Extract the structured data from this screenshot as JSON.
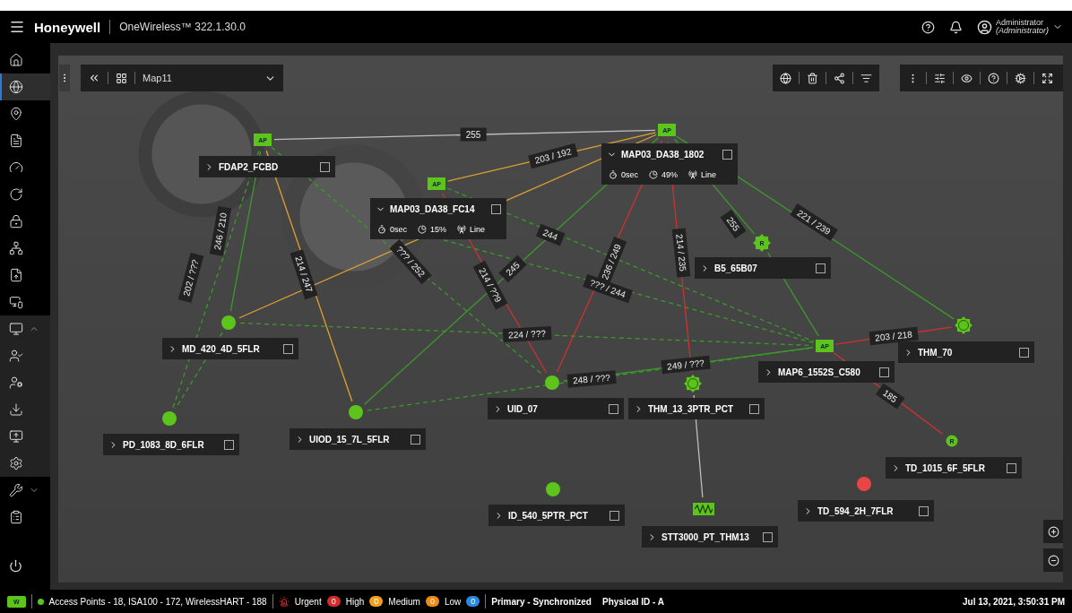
{
  "header": {
    "brand": "Honeywell",
    "product": "OneWireless™ 322.1.30.0",
    "user": {
      "name": "Administrator",
      "role": "(Administrator)"
    }
  },
  "sidebar": {
    "items": [
      {
        "selected": false
      },
      {
        "selected": true
      },
      {
        "selected": false
      },
      {
        "selected": false
      },
      {
        "selected": false
      },
      {
        "selected": false
      },
      {
        "selected": false
      },
      {
        "selected": false
      },
      {
        "selected": false
      },
      {
        "selected": false
      },
      {
        "selected": false,
        "expanded": true,
        "children": [
          {
            "selected": false
          },
          {
            "selected": false
          },
          {
            "selected": false
          },
          {
            "selected": false
          },
          {
            "selected": false
          }
        ]
      },
      {
        "selected": false,
        "expanded": false
      },
      {
        "selected": false
      }
    ]
  },
  "map_toolbar": {
    "map_name": "Map11"
  },
  "nodes": [
    {
      "name": "FDAP2_FCBD",
      "expanded": false,
      "checked": false,
      "marker": {
        "kind": "ap",
        "label": "AP",
        "color": "#5cc41a"
      }
    },
    {
      "name": "MAP03_DA38_1802",
      "expanded": true,
      "checked": false,
      "marker": {
        "kind": "ap",
        "label": "AP",
        "color": "#5cc41a"
      },
      "details": [
        "0sec",
        "49%",
        "Line"
      ]
    },
    {
      "name": "MAP03_DA38_FC14",
      "expanded": true,
      "checked": false,
      "marker": {
        "kind": "ap",
        "label": "AP",
        "color": "#5cc41a"
      },
      "details": [
        "0sec",
        "15%",
        "Line"
      ]
    },
    {
      "name": "B5_65B07",
      "expanded": false,
      "checked": false,
      "marker": {
        "kind": "sun",
        "label": "R",
        "color": "#5cc41a"
      }
    },
    {
      "name": "MD_420_4D_5FLR",
      "expanded": false,
      "checked": false,
      "marker": {
        "kind": "circle",
        "color": "#5cc41a"
      }
    },
    {
      "name": "THM_70",
      "expanded": false,
      "checked": false,
      "marker": {
        "kind": "sun",
        "color": "#5cc41a"
      }
    },
    {
      "name": "MAP6_1552S_C580",
      "expanded": false,
      "checked": false,
      "marker": {
        "kind": "ap",
        "label": "AP",
        "color": "#5cc41a"
      }
    },
    {
      "name": "UID_07",
      "expanded": false,
      "checked": false,
      "marker": {
        "kind": "circle",
        "color": "#5cc41a"
      }
    },
    {
      "name": "THM_13_3PTR_PCT",
      "expanded": false,
      "checked": false,
      "marker": {
        "kind": "sun",
        "color": "#5cc41a"
      }
    },
    {
      "name": "PD_1083_8D_6FLR",
      "expanded": false,
      "checked": false,
      "marker": {
        "kind": "circle",
        "color": "#5cc41a"
      }
    },
    {
      "name": "UIOD_15_7L_5FLR",
      "expanded": false,
      "checked": false,
      "marker": {
        "kind": "circle",
        "color": "#5cc41a"
      }
    },
    {
      "name": "TD_1015_6F_5FLR",
      "expanded": false,
      "checked": false,
      "marker": {
        "kind": "circle",
        "label": "R",
        "color": "#5cc41a"
      }
    },
    {
      "name": "ID_540_5PTR_PCT",
      "expanded": false,
      "checked": false,
      "marker": {
        "kind": "circle",
        "color": "#5cc41a"
      }
    },
    {
      "name": "TD_594_2H_7FLR",
      "expanded": false,
      "checked": false,
      "marker": {
        "kind": "circle",
        "color": "#e84545"
      }
    },
    {
      "name": "STT3000_PT_THM13",
      "expanded": false,
      "checked": false,
      "marker": {
        "kind": "wave",
        "color": "#5cc41a"
      }
    }
  ],
  "links": [
    {
      "label": "255",
      "color": "#bdbdbd",
      "kind": "solid"
    },
    {
      "label": "203 / 192",
      "color": "#e0a030",
      "kind": "solid"
    },
    {
      "label": "214 / 247",
      "color": "#e0a030",
      "kind": "solid"
    },
    {
      "label": "246 / 210",
      "color": "#3a9a2a",
      "kind": "solid"
    },
    {
      "label": "202 / ???",
      "color": "#3a9a2a",
      "kind": "dashed"
    },
    {
      "color": "#e0a030",
      "kind": "solid"
    },
    {
      "label": "??? / 252",
      "color": "#3a9a2a",
      "kind": "dashed"
    },
    {
      "label": "214 / ??9",
      "color": "#d03030",
      "kind": "solid"
    },
    {
      "label": "245",
      "color": "#3a9a2a",
      "kind": "solid"
    },
    {
      "label": "244",
      "color": "#3a9a2a",
      "kind": "dashed"
    },
    {
      "label": "236 / 249",
      "color": "#d03030",
      "kind": "solid"
    },
    {
      "label": "??? / 244",
      "color": "#3a9a2a",
      "kind": "dashed"
    },
    {
      "label": "214 / 235",
      "color": "#d03030",
      "kind": "solid"
    },
    {
      "label": "255",
      "color": "#3a9a2a",
      "kind": "solid"
    },
    {
      "label": "221 / 239",
      "color": "#3a9a2a",
      "kind": "solid"
    },
    {
      "label": "224 / ???",
      "color": "#3a9a2a",
      "kind": "dashed"
    },
    {
      "label": "248 / ???",
      "color": "#3a9a2a",
      "kind": "solid"
    },
    {
      "label": "249 / ???",
      "color": "#3a9a2a",
      "kind": "dashed"
    },
    {
      "label": "203 / 218",
      "color": "#d03030",
      "kind": "solid"
    },
    {
      "label": "185",
      "color": "#d03030",
      "kind": "solid"
    },
    {
      "color": "#bdbdbd",
      "kind": "solid"
    },
    {
      "color": "#3a9a2a",
      "kind": "solid"
    },
    {
      "color": "#3a9a2a",
      "kind": "dashed"
    }
  ],
  "status_bar": {
    "network_badge": "W",
    "summary": "Access Points - 18, ISA100 - 172, WirelessHART - 188",
    "alarms": [
      {
        "label": "Urgent",
        "count": "0",
        "color": "#d62b2b"
      },
      {
        "label": "High",
        "count": "0",
        "color": "#f0a020"
      },
      {
        "label": "Medium",
        "count": "0",
        "color": "#f08a10"
      },
      {
        "label": "Low",
        "count": "0",
        "color": "#2a8ae0"
      }
    ],
    "sync": "Primary - Synchronized",
    "physical_id": "Physical ID - A",
    "datetime": "Jul 13, 2021, 3:50:31 PM"
  }
}
